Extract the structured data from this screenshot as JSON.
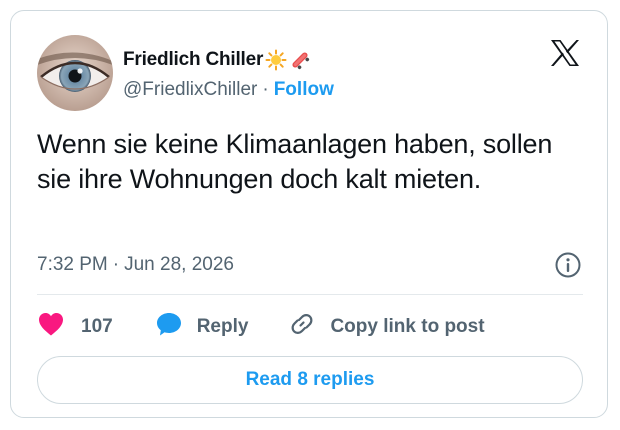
{
  "author": {
    "display_name": "Friedlich Chiller",
    "name_emojis": [
      "sun-emoji",
      "skateboard-emoji"
    ],
    "handle": "@FriedlixChiller",
    "separator": "·",
    "follow_label": "Follow"
  },
  "tweet": {
    "text": "Wenn sie keine Klimaanlagen haben, sollen sie ihre Wohnungen doch kalt mieten.",
    "time": "7:32 PM",
    "date_separator": "·",
    "date": "Jun 28, 2026"
  },
  "actions": {
    "like_count": "107",
    "reply_label": "Reply",
    "copy_label": "Copy link to post"
  },
  "read_replies_label": "Read 8 replies",
  "colors": {
    "accent": "#1d9bf0",
    "like": "#f91880",
    "text": "#0f1419",
    "secondary": "#536471",
    "border": "#cfd9de"
  },
  "icons": {
    "brand": "x-logo-icon",
    "info": "info-icon",
    "like": "heart-icon",
    "reply": "speech-bubble-icon",
    "copy": "link-icon"
  }
}
